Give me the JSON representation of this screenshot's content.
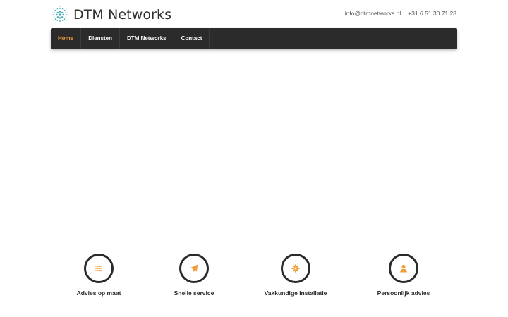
{
  "header": {
    "logo_text": "DTM Networks",
    "email": "info@dtmnetworks.nl",
    "phone": "+31 6 51 30 71 28"
  },
  "nav": {
    "items": [
      {
        "label": "Home",
        "active": true
      },
      {
        "label": "Diensten",
        "active": false
      },
      {
        "label": "DTM Networks",
        "active": false
      },
      {
        "label": "Contact",
        "active": false
      }
    ]
  },
  "features": [
    {
      "label": "Advies op maat",
      "icon": "sliders-icon"
    },
    {
      "label": "Snelle service",
      "icon": "paper-plane-icon"
    },
    {
      "label": "Vakkundige installatie",
      "icon": "gear-icon"
    },
    {
      "label": "Persoonlijk advies",
      "icon": "user-icon"
    }
  ],
  "colors": {
    "accent": "#f0a03a",
    "nav_background": "#2b2b2b",
    "logo_teal": "#3aa8b5"
  }
}
